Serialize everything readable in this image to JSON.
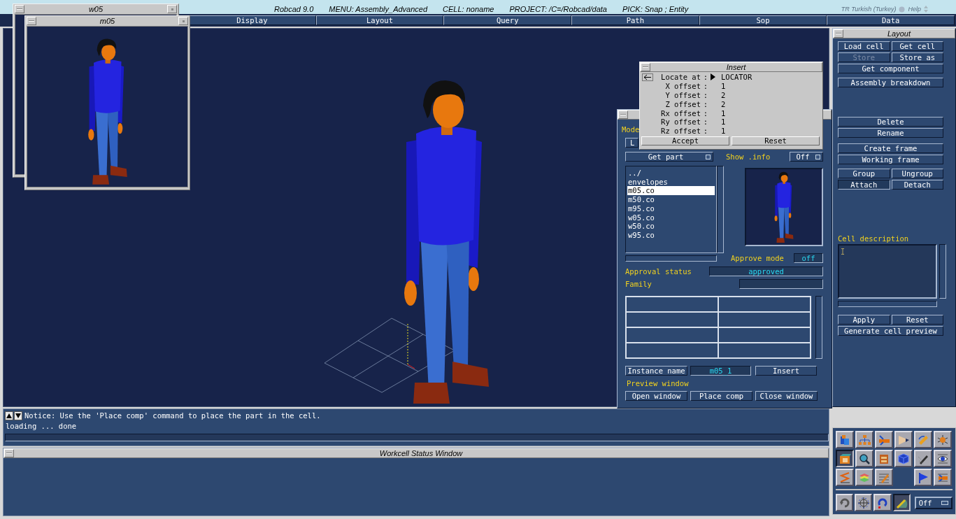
{
  "app_bar": {
    "title_fields": [
      "Robcad 9.0",
      "MENU: Assembly_Advanced",
      "CELL: noname",
      "PROJECT: /C=/Robcad/data",
      "PICK: Snap ; Entity"
    ],
    "language": "TR Turkish (Turkey)",
    "help": "Help"
  },
  "menu": [
    "Display",
    "Layout",
    "Query",
    "Path",
    "Sop",
    "Data"
  ],
  "model_windows": [
    {
      "title": "w05"
    },
    {
      "title": "m05"
    }
  ],
  "insert_dialog": {
    "title": "Insert",
    "fields": [
      {
        "label": "Locate at",
        "value": "LOCATOR",
        "kind": "pick"
      },
      {
        "label": "X offset",
        "value": "1",
        "kind": "value"
      },
      {
        "label": "Y offset",
        "value": "2",
        "kind": "value"
      },
      {
        "label": "Z offset",
        "value": "2",
        "kind": "value"
      },
      {
        "label": "Rx offset",
        "value": "1",
        "kind": "value"
      },
      {
        "label": "Ry offset",
        "value": "1",
        "kind": "value"
      },
      {
        "label": "Rz offset",
        "value": "1",
        "kind": "value"
      }
    ],
    "separator": ":",
    "buttons": [
      "Accept",
      "Reset"
    ]
  },
  "model_panel": {
    "title": "Mode",
    "first_button": "L",
    "get_part": "Get part",
    "show_info": {
      "label": "Show .info",
      "value": "Off"
    },
    "files": [
      {
        "name": "../",
        "selected": false
      },
      {
        "name": "envelopes",
        "selected": false
      },
      {
        "name": "m05.co",
        "selected": true
      },
      {
        "name": "m50.co",
        "selected": false
      },
      {
        "name": "m95.co",
        "selected": false
      },
      {
        "name": "w05.co",
        "selected": false
      },
      {
        "name": "w50.co",
        "selected": false
      },
      {
        "name": "w95.co",
        "selected": false
      }
    ],
    "approve_mode": {
      "label": "Approve mode",
      "value": "off"
    },
    "approval_status": {
      "label": "Approval status",
      "value": "approved"
    },
    "family": {
      "label": "Family"
    },
    "instance_name": {
      "label": "Instance name",
      "value": "m05_1"
    },
    "insert_button": "Insert",
    "preview_label": "Preview window",
    "preview_buttons": [
      "Open window",
      "Place comp",
      "Close window"
    ]
  },
  "layout_panel": {
    "title": "Layout",
    "sections": [
      [
        [
          {
            "label": "Load cell",
            "disabled": false,
            "pressed": false
          },
          {
            "label": "Get cell",
            "disabled": false,
            "pressed": false
          }
        ],
        [
          {
            "label": "Store",
            "disabled": true,
            "pressed": false
          },
          {
            "label": "Store as",
            "disabled": false,
            "pressed": false
          }
        ],
        [
          {
            "label": "Get component",
            "disabled": false,
            "pressed": false
          }
        ]
      ],
      [
        [
          {
            "label": "Assembly breakdown",
            "disabled": false,
            "pressed": false
          }
        ]
      ],
      [
        [
          {
            "label": "Delete",
            "disabled": false,
            "pressed": false
          }
        ],
        [
          {
            "label": "Rename",
            "disabled": false,
            "pressed": false
          }
        ]
      ],
      [
        [
          {
            "label": "Create frame",
            "disabled": false,
            "pressed": false
          }
        ],
        [
          {
            "label": "Working frame",
            "disabled": false,
            "pressed": false
          }
        ]
      ],
      [
        [
          {
            "label": "Group",
            "disabled": false,
            "pressed": false
          },
          {
            "label": "Ungroup",
            "disabled": false,
            "pressed": false
          }
        ],
        [
          {
            "label": "Attach",
            "disabled": false,
            "pressed": true
          },
          {
            "label": "Detach",
            "disabled": false,
            "pressed": false
          }
        ]
      ]
    ],
    "cell_description_label": "Cell description",
    "buttons": [
      "Apply",
      "Reset"
    ],
    "generate_button": "Generate cell preview"
  },
  "messages": {
    "notice": "Notice: Use the 'Place comp' command to place the part in the cell.",
    "log": "loading ... done"
  },
  "status_window": {
    "title": "Workcell Status Window"
  },
  "tool_palette": {
    "tools": [
      {
        "selected": false
      },
      {
        "selected": false
      },
      {
        "selected": false
      },
      {
        "selected": false
      },
      {
        "selected": false
      },
      {
        "selected": false
      },
      {
        "selected": true
      },
      {
        "selected": false
      },
      {
        "selected": false
      },
      {
        "selected": false
      },
      {
        "selected": false
      },
      {
        "selected": false
      },
      {
        "selected": false
      },
      {
        "selected": false
      },
      {
        "selected": false
      },
      {
        "selected": false
      },
      {
        "selected": false
      }
    ],
    "view_tools": [
      {
        "selected": false
      },
      {
        "selected": false
      },
      {
        "selected": false
      },
      {
        "selected": true
      }
    ],
    "mode": "Off"
  }
}
